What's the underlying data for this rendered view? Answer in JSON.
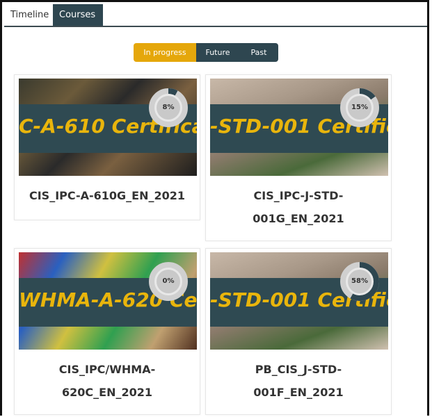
{
  "tabs": [
    {
      "label": "Timeline",
      "active": false
    },
    {
      "label": "Courses",
      "active": true
    }
  ],
  "filter": {
    "in_progress": "In progress",
    "future": "Future",
    "past": "Past",
    "selected": "In progress"
  },
  "colors": {
    "accent": "#e5a70b",
    "dark": "#2e4650",
    "banner_text": "#e9b50c"
  },
  "courses": [
    {
      "title_line1": "CIS_IPC-A-610G_EN_2021",
      "title_line2": "",
      "banner": "C-A-610 Certifica",
      "progress": 8,
      "progress_label": "8%"
    },
    {
      "title_line1": "CIS_IPC-J-STD-",
      "title_line2": "001G_EN_2021",
      "banner": "-STD-001 Certific",
      "progress": 15,
      "progress_label": "15%"
    },
    {
      "title_line1": "CIS_IPC/WHMA-",
      "title_line2": "620C_EN_2021",
      "banner": "WHMA-A-620 Certifi",
      "progress": 0,
      "progress_label": "0%"
    },
    {
      "title_line1": "PB_CIS_J-STD-",
      "title_line2": "001F_EN_2021",
      "banner": "-STD-001 Certific",
      "progress": 58,
      "progress_label": "58%"
    }
  ]
}
